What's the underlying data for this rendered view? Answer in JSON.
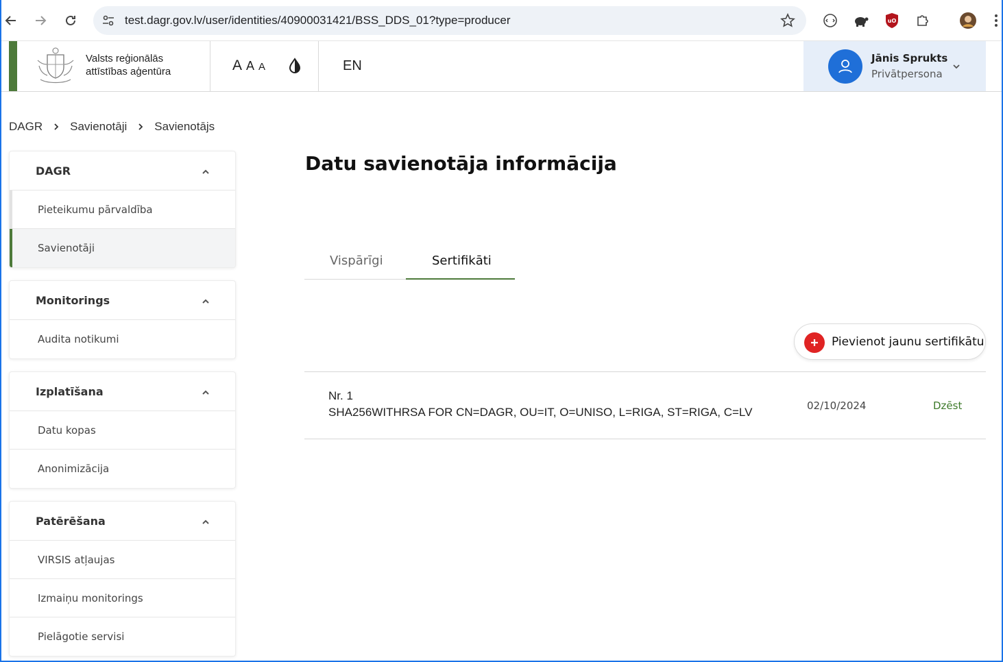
{
  "browser": {
    "url": "test.dagr.gov.lv/user/identities/40900031421/BSS_DDS_01?type=producer"
  },
  "header": {
    "org_line1": "Valsts reģionālās",
    "org_line2": "attīstības aģentūra",
    "font_a_large": "A",
    "font_a_medium": "A",
    "font_a_small": "A",
    "language": "EN",
    "user_name": "Jānis Sprukts",
    "user_role": "Privātpersona"
  },
  "breadcrumb": [
    "DAGR",
    "Savienotāji",
    "Savienotājs"
  ],
  "sidebar": {
    "groups": [
      {
        "title": "DAGR",
        "items": [
          "Pieteikumu pārvaldība",
          "Savienotāji"
        ]
      },
      {
        "title": "Monitorings",
        "items": [
          "Audita notikumi"
        ]
      },
      {
        "title": "Izplatīšana",
        "items": [
          "Datu kopas",
          "Anonimizācija"
        ]
      },
      {
        "title": "Patērēšana",
        "items": [
          "VIRSIS atļaujas",
          "Izmaiņu monitorings",
          "Pielāgotie servisi"
        ]
      }
    ],
    "active_item": "Savienotāji"
  },
  "main": {
    "title": "Datu savienotāja informācija",
    "tabs": [
      "Vispārīgi",
      "Sertifikāti"
    ],
    "active_tab": "Sertifikāti",
    "add_button": "Pievienot jaunu sertifikātu",
    "certificates": [
      {
        "number": "Nr. 1",
        "subject": "SHA256WITHRSA FOR CN=DAGR, OU=IT, O=UNISO, L=RIGA, ST=RIGA, C=LV",
        "date": "02/10/2024",
        "action": "Dzēst"
      }
    ]
  },
  "colors": {
    "brand_green": "#4d7a3a",
    "accent_blue": "#1f6fd8",
    "add_red": "#e02424"
  }
}
